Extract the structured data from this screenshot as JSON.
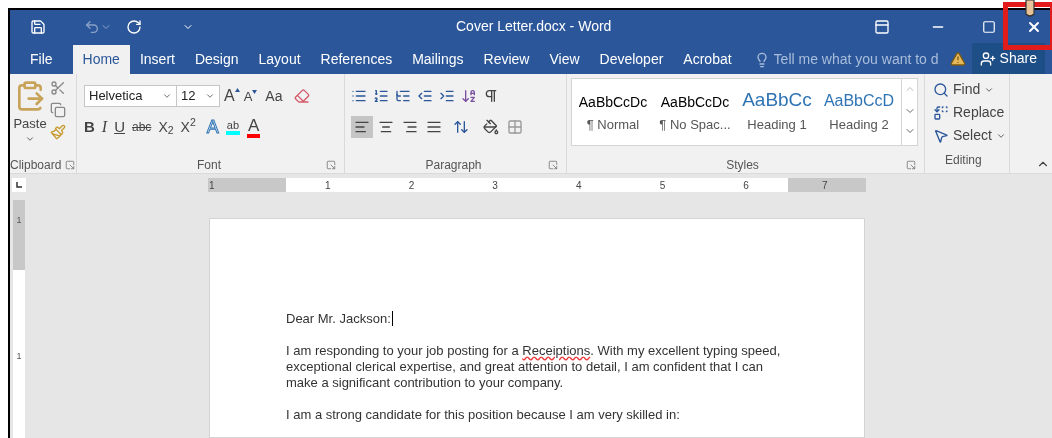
{
  "window": {
    "title": "Cover Letter.docx - Word"
  },
  "tabs": [
    {
      "label": "File",
      "selected": false
    },
    {
      "label": "Home",
      "selected": true
    },
    {
      "label": "Insert",
      "selected": false
    },
    {
      "label": "Design",
      "selected": false
    },
    {
      "label": "Layout",
      "selected": false
    },
    {
      "label": "References",
      "selected": false
    },
    {
      "label": "Mailings",
      "selected": false
    },
    {
      "label": "Review",
      "selected": false
    },
    {
      "label": "View",
      "selected": false
    },
    {
      "label": "Developer",
      "selected": false
    },
    {
      "label": "Acrobat",
      "selected": false
    }
  ],
  "tell_me": {
    "placeholder": "Tell me what you want to d"
  },
  "share": "Share",
  "clipboard": {
    "paste": "Paste",
    "label": "Clipboard"
  },
  "font": {
    "name": "Helvetica",
    "size": "12",
    "grow": "A",
    "shrink": "A",
    "change_case": "Aa",
    "text_effects": "A",
    "font_color": "A",
    "bold": "B",
    "italic": "I",
    "underline": "U",
    "strike": "abc",
    "subscript": "X$_{2}$",
    "superscript": "X$^{2}$",
    "highlight": "ab",
    "label": "Font"
  },
  "paragraph": {
    "label": "Paragraph",
    "alignment": [
      {
        "kind": "left",
        "selected": true
      },
      {
        "kind": "center",
        "selected": false
      },
      {
        "kind": "right",
        "selected": false
      },
      {
        "kind": "justify",
        "selected": false
      }
    ]
  },
  "styles": {
    "label": "Styles",
    "items": [
      {
        "preview": "AaBbCcDc",
        "name": "¶ Normal",
        "kind": "body"
      },
      {
        "preview": "AaBbCcDc",
        "name": "¶ No Spac...",
        "kind": "body"
      },
      {
        "preview": "AaBbCc",
        "name": "Heading 1",
        "kind": "heading1"
      },
      {
        "preview": "AaBbCcD",
        "name": "Heading 2",
        "kind": "heading2"
      }
    ]
  },
  "editing": {
    "label": "Editing",
    "items": [
      {
        "kind": "find",
        "label": "Find"
      },
      {
        "kind": "replace",
        "label": "Replace"
      },
      {
        "kind": "select",
        "label": "Select"
      }
    ]
  },
  "ruler": {
    "numbers": [
      "1",
      "1",
      "2",
      "3",
      "4",
      "5",
      "6",
      "7"
    ]
  },
  "vertical_ruler": {
    "numbers": [
      "1",
      "1"
    ]
  },
  "document": {
    "greeting": "Dear Mr. Jackson:",
    "paragraph_1": {
      "before": "I am responding to your job posting for a ",
      "misspelled": "Receiptions",
      "after": ". With my excellent typing speed, exceptional clerical expertise, and great attention to detail, I am confident that I can make a significant contribution to your company."
    },
    "paragraph_2": "I am a strong candidate for this position because I am very skilled in:"
  }
}
